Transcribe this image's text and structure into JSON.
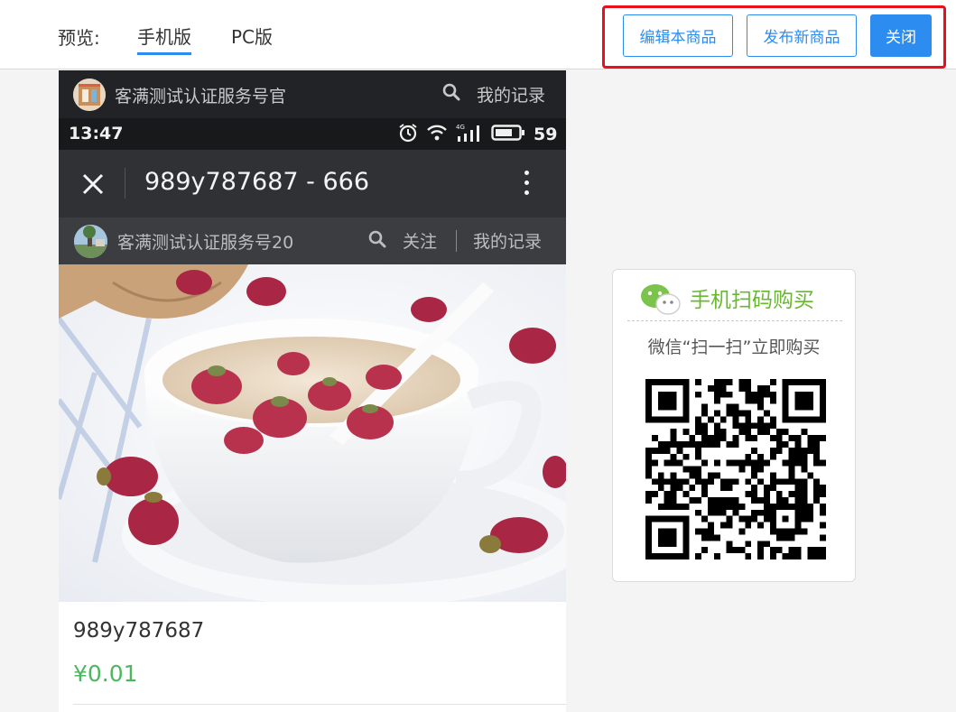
{
  "header": {
    "preview_label": "预览:",
    "tabs": [
      {
        "label": "手机版",
        "active": true
      },
      {
        "label": "PC版",
        "active": false
      }
    ],
    "buttons": {
      "edit": "编辑本商品",
      "publish": "发布新商品",
      "close": "关闭"
    }
  },
  "phone": {
    "account_bar": {
      "name": "客满测试认证服务号官",
      "records": "我的记录"
    },
    "status_bar": {
      "time": "13:47",
      "network": "4G",
      "battery": "59"
    },
    "nav": {
      "title": "989y787687 - 666"
    },
    "sub_bar": {
      "name": "客满测试认证服务号20",
      "follow": "关注",
      "records": "我的记录"
    },
    "product": {
      "name": "989y787687",
      "price": "¥0.01"
    }
  },
  "qr_card": {
    "title": "手机扫码购买",
    "subtitle": "微信“扫一扫”立即购买"
  },
  "colors": {
    "accent": "#2d8cf0",
    "highlight_frame": "#e8101b",
    "price": "#4cb75e",
    "wechat_green": "#68b930"
  }
}
